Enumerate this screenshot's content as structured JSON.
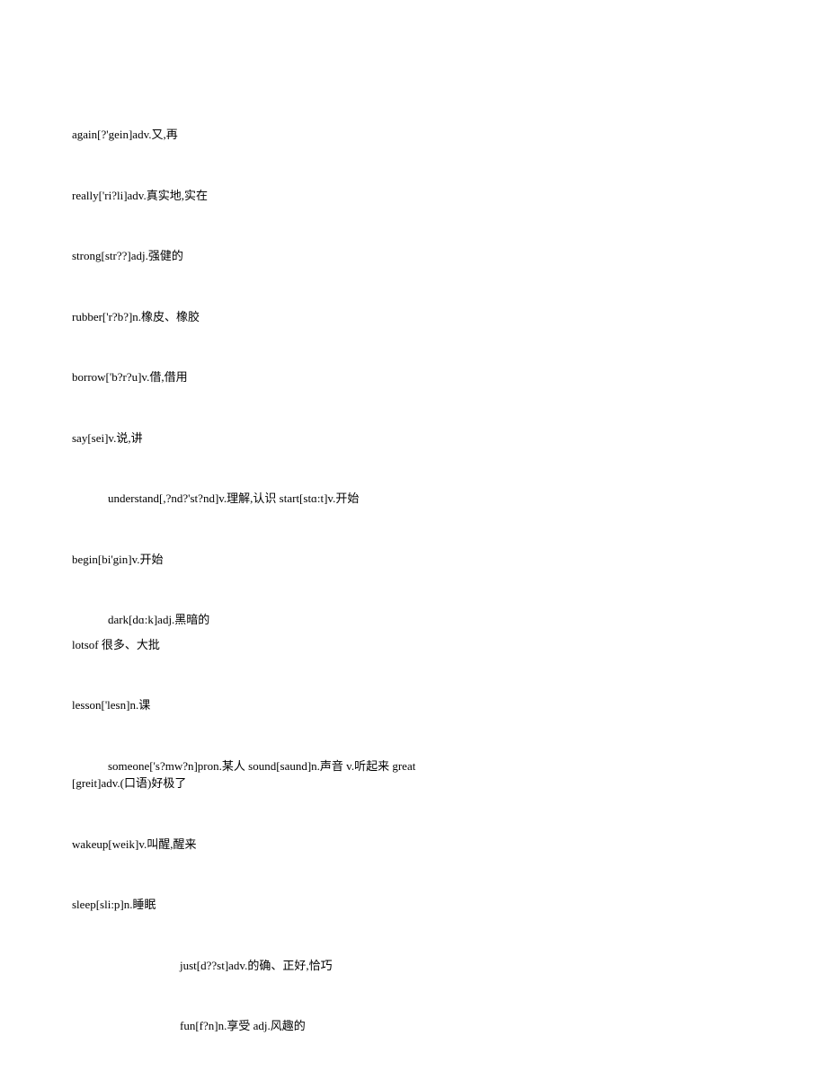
{
  "entries": [
    {
      "text": "again[?'gein]adv.又,再",
      "class": "entry"
    },
    {
      "text": "really['ri?li]adv.真实地,实在",
      "class": "entry"
    },
    {
      "text": "strong[str??]adj.强健的",
      "class": "entry"
    },
    {
      "text": "rubber['r?b?]n.橡皮、橡胶",
      "class": "entry"
    },
    {
      "text": "borrow['b?r?u]v.借,借用",
      "class": "entry"
    },
    {
      "text": "say[sei]v.说,讲",
      "class": "entry"
    },
    {
      "text": "understand[,?nd?'st?nd]v.理解,认识 start[stɑ:t]v.开始",
      "class": "entry-indent",
      "mb": "48"
    },
    {
      "text": "begin[bi'gin]v.开始",
      "class": "entry"
    },
    {
      "text": "dark[dɑ:k]adj.黑暗的",
      "class": "entry-indent"
    },
    {
      "text": "lotsof 很多、大批",
      "class": "entry"
    },
    {
      "text": "lesson['lesn]n.课",
      "class": "entry"
    },
    {
      "text": "someone['s?mw?n]pron.某人 sound[saund]n.声音 v.听起来 great",
      "class": "entry-indent no-bottom"
    },
    {
      "text": "[greit]adv.(口语)好极了",
      "class": "entry"
    },
    {
      "text": "wakeup[weik]v.叫醒,醒来",
      "class": "entry"
    },
    {
      "text": "sleep[sli:p]n.睡眠",
      "class": "entry"
    },
    {
      "text": "just[d??st]adv.的确、正好,恰巧",
      "class": "entry-indent-wide"
    },
    {
      "text": "fun[f?n]n.享受 adj.风趣的",
      "class": "entry-indent-wide"
    }
  ]
}
